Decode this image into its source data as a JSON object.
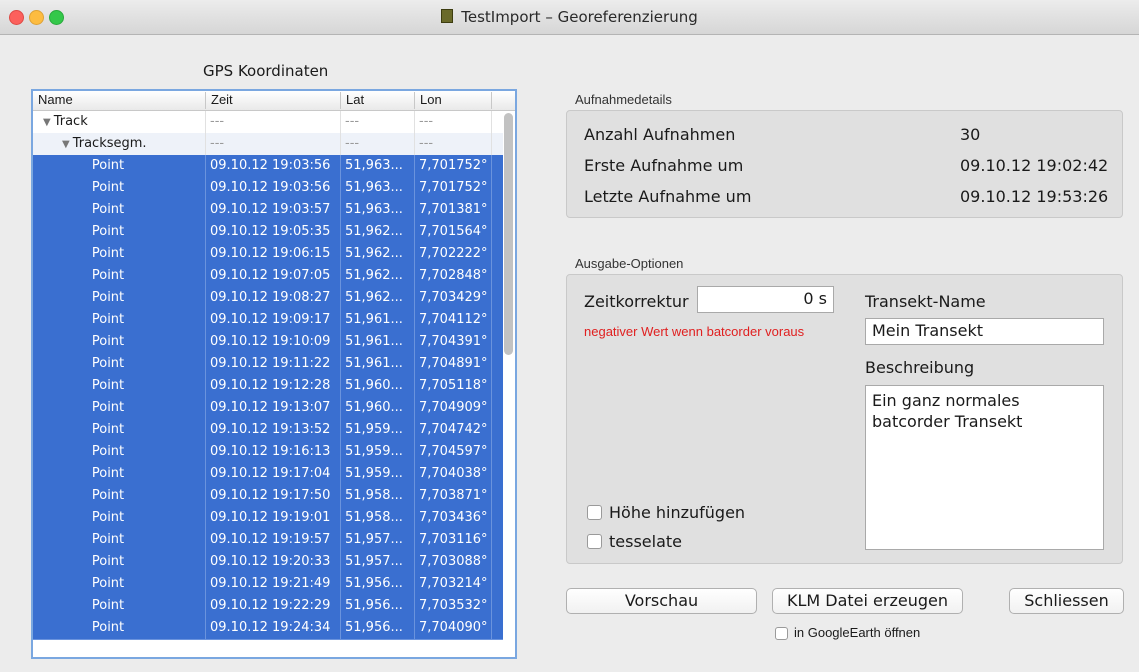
{
  "window": {
    "title": "TestImport – Georeferenzierung"
  },
  "gps": {
    "title": "GPS Koordinaten",
    "columns": [
      "Name",
      "Zeit",
      "Lat",
      "Lon"
    ],
    "track": {
      "name": "Track",
      "zeit": "---",
      "lat": "---",
      "lon": "---"
    },
    "segment": {
      "name": "Tracksegm.",
      "zeit": "---",
      "lat": "---",
      "lon": "---"
    },
    "points": [
      {
        "name": "Point",
        "zeit": "09.10.12 19:03:56",
        "lat": "51,963...",
        "lon": "7,701752°"
      },
      {
        "name": "Point",
        "zeit": "09.10.12 19:03:56",
        "lat": "51,963...",
        "lon": "7,701752°"
      },
      {
        "name": "Point",
        "zeit": "09.10.12 19:03:57",
        "lat": "51,963...",
        "lon": "7,701381°"
      },
      {
        "name": "Point",
        "zeit": "09.10.12 19:05:35",
        "lat": "51,962...",
        "lon": "7,701564°"
      },
      {
        "name": "Point",
        "zeit": "09.10.12 19:06:15",
        "lat": "51,962...",
        "lon": "7,702222°"
      },
      {
        "name": "Point",
        "zeit": "09.10.12 19:07:05",
        "lat": "51,962...",
        "lon": "7,702848°"
      },
      {
        "name": "Point",
        "zeit": "09.10.12 19:08:27",
        "lat": "51,962...",
        "lon": "7,703429°"
      },
      {
        "name": "Point",
        "zeit": "09.10.12 19:09:17",
        "lat": "51,961...",
        "lon": "7,704112°"
      },
      {
        "name": "Point",
        "zeit": "09.10.12 19:10:09",
        "lat": "51,961...",
        "lon": "7,704391°"
      },
      {
        "name": "Point",
        "zeit": "09.10.12 19:11:22",
        "lat": "51,961...",
        "lon": "7,704891°"
      },
      {
        "name": "Point",
        "zeit": "09.10.12 19:12:28",
        "lat": "51,960...",
        "lon": "7,705118°"
      },
      {
        "name": "Point",
        "zeit": "09.10.12 19:13:07",
        "lat": "51,960...",
        "lon": "7,704909°"
      },
      {
        "name": "Point",
        "zeit": "09.10.12 19:13:52",
        "lat": "51,959...",
        "lon": "7,704742°"
      },
      {
        "name": "Point",
        "zeit": "09.10.12 19:16:13",
        "lat": "51,959...",
        "lon": "7,704597°"
      },
      {
        "name": "Point",
        "zeit": "09.10.12 19:17:04",
        "lat": "51,959...",
        "lon": "7,704038°"
      },
      {
        "name": "Point",
        "zeit": "09.10.12 19:17:50",
        "lat": "51,958...",
        "lon": "7,703871°"
      },
      {
        "name": "Point",
        "zeit": "09.10.12 19:19:01",
        "lat": "51,958...",
        "lon": "7,703436°"
      },
      {
        "name": "Point",
        "zeit": "09.10.12 19:19:57",
        "lat": "51,957...",
        "lon": "7,703116°"
      },
      {
        "name": "Point",
        "zeit": "09.10.12 19:20:33",
        "lat": "51,957...",
        "lon": "7,703088°"
      },
      {
        "name": "Point",
        "zeit": "09.10.12 19:21:49",
        "lat": "51,956...",
        "lon": "7,703214°"
      },
      {
        "name": "Point",
        "zeit": "09.10.12 19:22:29",
        "lat": "51,956...",
        "lon": "7,703532°"
      },
      {
        "name": "Point",
        "zeit": "09.10.12 19:24:34",
        "lat": "51,956...",
        "lon": "7,704090°"
      }
    ]
  },
  "details": {
    "group_label": "Aufnahmedetails",
    "count_label": "Anzahl Aufnahmen",
    "count_value": "30",
    "first_label": "Erste Aufnahme um",
    "first_value": "09.10.12 19:02:42",
    "last_label": "Letzte Aufnahme um",
    "last_value": "09.10.12 19:53:26"
  },
  "options": {
    "group_label": "Ausgabe-Optionen",
    "zeit_label": "Zeitkorrektur",
    "zeit_value": "0 s",
    "warning": "negativer Wert wenn batcorder voraus",
    "transekt_label": "Transekt-Name",
    "transekt_value": "Mein Transekt",
    "beschreibung_label": "Beschreibung",
    "beschreibung_value": "Ein ganz normales batcorder Transekt",
    "hoehe_label": "Höhe hinzufügen",
    "tesselate_label": "tesselate"
  },
  "buttons": {
    "vorschau": "Vorschau",
    "klm": "KLM Datei erzeugen",
    "schliessen": "Schliessen",
    "googleearth_label": "in GoogleEarth öffnen"
  },
  "colors": {
    "selection": "#3a6fd0",
    "warning": "#e02020"
  }
}
